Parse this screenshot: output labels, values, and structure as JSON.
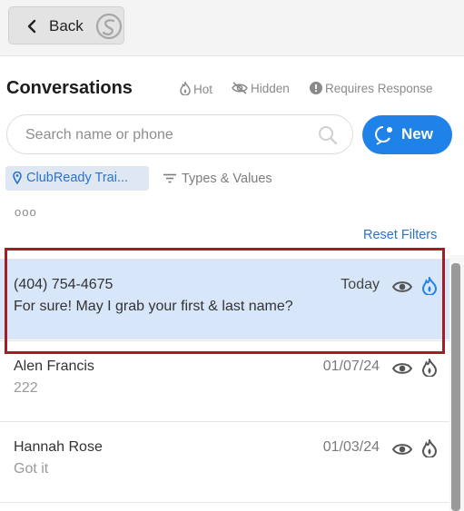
{
  "header": {
    "back_label": "Back",
    "logo_icon": "app-logo-icon"
  },
  "conversations": {
    "title": "Conversations",
    "legend": {
      "hot": "Hot",
      "hidden": "Hidden",
      "requires_response": "Requires Response"
    }
  },
  "search": {
    "placeholder": "Search name or phone",
    "value": ""
  },
  "new_button": {
    "label": "New"
  },
  "filters": {
    "location": "ClubReady Trai...",
    "types": "Types & Values",
    "more": "ooo",
    "reset": "Reset Filters"
  },
  "rows": [
    {
      "name": "(404) 754-4675",
      "preview": "For sure! May I grab your first & last name?",
      "date": "Today",
      "active": true
    },
    {
      "name": "Alen Francis",
      "preview": "222",
      "date": "01/07/24",
      "active": false
    },
    {
      "name": "Hannah Rose",
      "preview": "Got it",
      "date": "01/03/24",
      "active": false
    }
  ],
  "colors": {
    "accent": "#1f82e8",
    "selected_row": "#d8e6fa",
    "highlight": "#a51d24",
    "link": "#2b73c8"
  }
}
